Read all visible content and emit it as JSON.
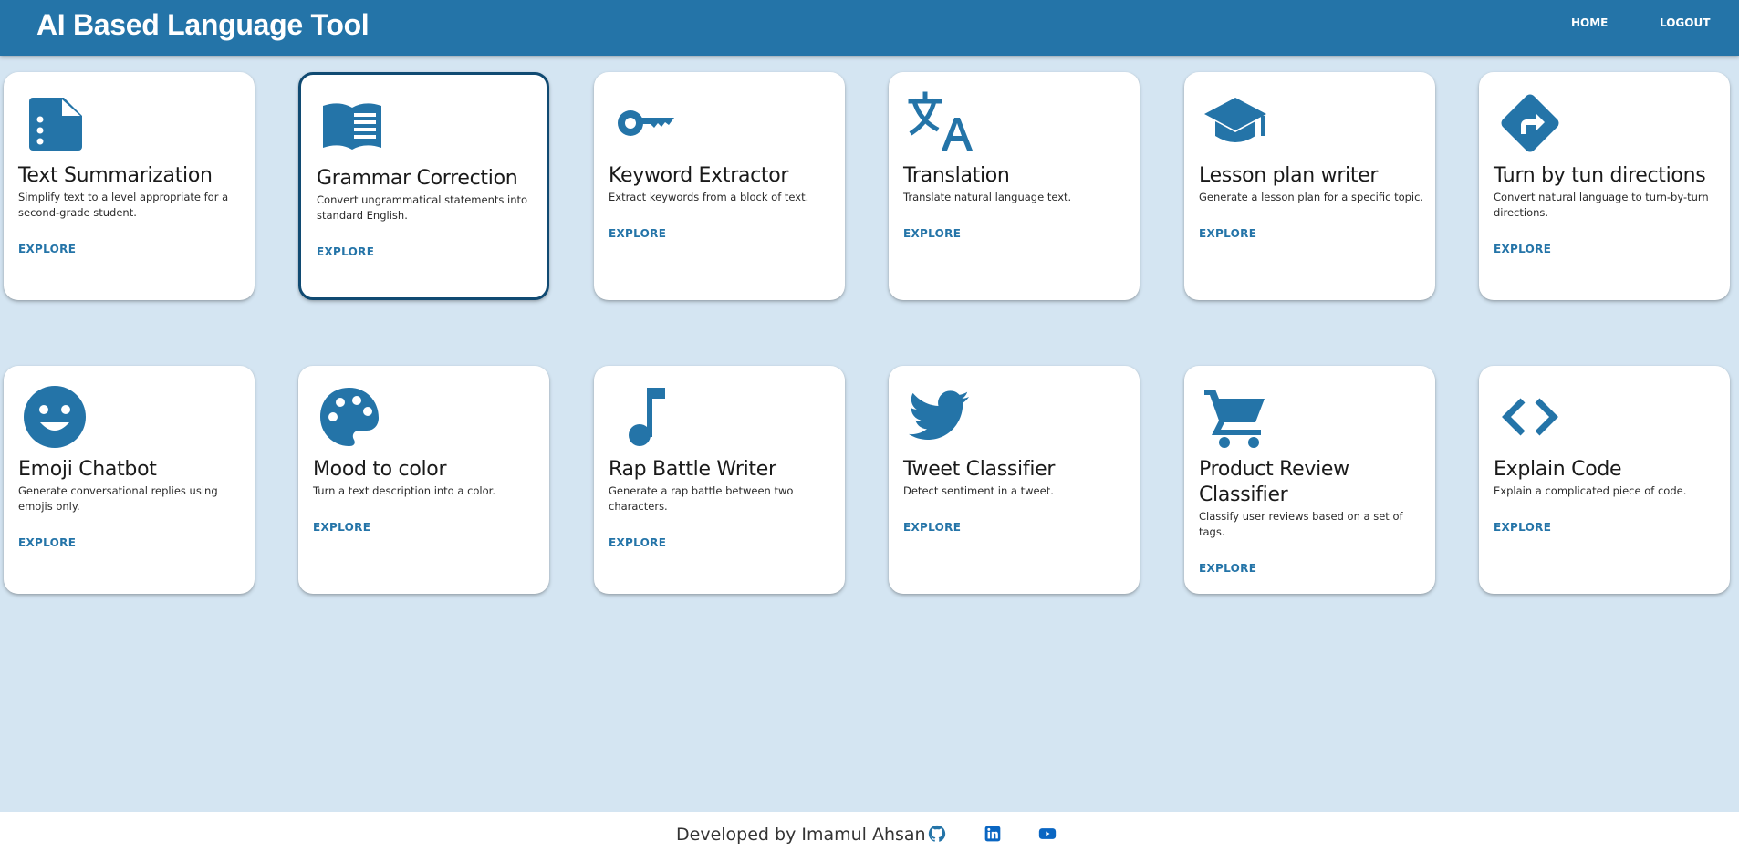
{
  "header": {
    "title": "AI Based Language Tool",
    "nav": {
      "home": "HOME",
      "logout": "LOGOUT"
    },
    "color": "#2474a8"
  },
  "cards": [
    {
      "icon": "document-list-icon",
      "title": "Text Summarization",
      "desc": "Simplify text to a level appropriate for a second-grade student.",
      "action": "EXPLORE"
    },
    {
      "icon": "open-book-icon",
      "title": "Grammar Correction",
      "desc": "Convert ungrammatical statements into standard English.",
      "action": "EXPLORE",
      "selected": true
    },
    {
      "icon": "key-icon",
      "title": "Keyword Extractor",
      "desc": "Extract keywords from a block of text.",
      "action": "EXPLORE"
    },
    {
      "icon": "translate-icon",
      "title": "Translation",
      "desc": "Translate natural language text.",
      "action": "EXPLORE"
    },
    {
      "icon": "graduation-cap-icon",
      "title": "Lesson plan writer",
      "desc": "Generate a lesson plan for a specific topic.",
      "action": "EXPLORE"
    },
    {
      "icon": "turn-right-sign-icon",
      "title": "Turn by tun directions",
      "desc": "Convert natural language to turn-by-turn directions.",
      "action": "EXPLORE"
    },
    {
      "icon": "smiley-face-icon",
      "title": "Emoji Chatbot",
      "desc": "Generate conversational replies using emojis only.",
      "action": "EXPLORE"
    },
    {
      "icon": "palette-icon",
      "title": "Mood to color",
      "desc": "Turn a text description into a color.",
      "action": "EXPLORE"
    },
    {
      "icon": "music-note-icon",
      "title": "Rap Battle Writer",
      "desc": "Generate a rap battle between two characters.",
      "action": "EXPLORE"
    },
    {
      "icon": "twitter-bird-icon",
      "title": "Tweet Classifier",
      "desc": "Detect sentiment in a tweet.",
      "action": "EXPLORE"
    },
    {
      "icon": "shopping-cart-icon",
      "title": "Product Review Classifier",
      "desc": "Classify user reviews based on a set of tags.",
      "action": "EXPLORE"
    },
    {
      "icon": "code-brackets-icon",
      "title": "Explain Code",
      "desc": "Explain a complicated piece of code.",
      "action": "EXPLORE"
    }
  ],
  "footer": {
    "text": "Developed by Imamul Ahsan",
    "icons": [
      "github-icon",
      "linkedin-icon",
      "youtube-icon"
    ]
  },
  "colors": {
    "accent": "#2474a8",
    "background": "#d4e5f2",
    "selected_border": "#104a72"
  }
}
